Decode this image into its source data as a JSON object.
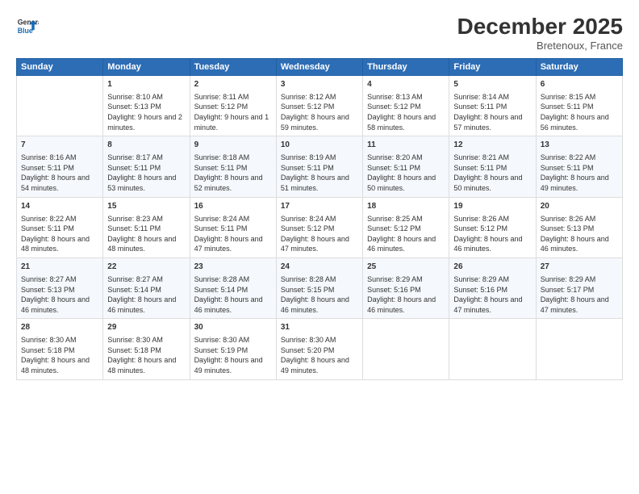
{
  "logo": {
    "line1": "General",
    "line2": "Blue"
  },
  "title": "December 2025",
  "subtitle": "Bretenoux, France",
  "days_header": [
    "Sunday",
    "Monday",
    "Tuesday",
    "Wednesday",
    "Thursday",
    "Friday",
    "Saturday"
  ],
  "weeks": [
    [
      {
        "day": "",
        "sunrise": "",
        "sunset": "",
        "daylight": ""
      },
      {
        "day": "1",
        "sunrise": "Sunrise: 8:10 AM",
        "sunset": "Sunset: 5:13 PM",
        "daylight": "Daylight: 9 hours and 2 minutes."
      },
      {
        "day": "2",
        "sunrise": "Sunrise: 8:11 AM",
        "sunset": "Sunset: 5:12 PM",
        "daylight": "Daylight: 9 hours and 1 minute."
      },
      {
        "day": "3",
        "sunrise": "Sunrise: 8:12 AM",
        "sunset": "Sunset: 5:12 PM",
        "daylight": "Daylight: 8 hours and 59 minutes."
      },
      {
        "day": "4",
        "sunrise": "Sunrise: 8:13 AM",
        "sunset": "Sunset: 5:12 PM",
        "daylight": "Daylight: 8 hours and 58 minutes."
      },
      {
        "day": "5",
        "sunrise": "Sunrise: 8:14 AM",
        "sunset": "Sunset: 5:11 PM",
        "daylight": "Daylight: 8 hours and 57 minutes."
      },
      {
        "day": "6",
        "sunrise": "Sunrise: 8:15 AM",
        "sunset": "Sunset: 5:11 PM",
        "daylight": "Daylight: 8 hours and 56 minutes."
      }
    ],
    [
      {
        "day": "7",
        "sunrise": "Sunrise: 8:16 AM",
        "sunset": "Sunset: 5:11 PM",
        "daylight": "Daylight: 8 hours and 54 minutes."
      },
      {
        "day": "8",
        "sunrise": "Sunrise: 8:17 AM",
        "sunset": "Sunset: 5:11 PM",
        "daylight": "Daylight: 8 hours and 53 minutes."
      },
      {
        "day": "9",
        "sunrise": "Sunrise: 8:18 AM",
        "sunset": "Sunset: 5:11 PM",
        "daylight": "Daylight: 8 hours and 52 minutes."
      },
      {
        "day": "10",
        "sunrise": "Sunrise: 8:19 AM",
        "sunset": "Sunset: 5:11 PM",
        "daylight": "Daylight: 8 hours and 51 minutes."
      },
      {
        "day": "11",
        "sunrise": "Sunrise: 8:20 AM",
        "sunset": "Sunset: 5:11 PM",
        "daylight": "Daylight: 8 hours and 50 minutes."
      },
      {
        "day": "12",
        "sunrise": "Sunrise: 8:21 AM",
        "sunset": "Sunset: 5:11 PM",
        "daylight": "Daylight: 8 hours and 50 minutes."
      },
      {
        "day": "13",
        "sunrise": "Sunrise: 8:22 AM",
        "sunset": "Sunset: 5:11 PM",
        "daylight": "Daylight: 8 hours and 49 minutes."
      }
    ],
    [
      {
        "day": "14",
        "sunrise": "Sunrise: 8:22 AM",
        "sunset": "Sunset: 5:11 PM",
        "daylight": "Daylight: 8 hours and 48 minutes."
      },
      {
        "day": "15",
        "sunrise": "Sunrise: 8:23 AM",
        "sunset": "Sunset: 5:11 PM",
        "daylight": "Daylight: 8 hours and 48 minutes."
      },
      {
        "day": "16",
        "sunrise": "Sunrise: 8:24 AM",
        "sunset": "Sunset: 5:11 PM",
        "daylight": "Daylight: 8 hours and 47 minutes."
      },
      {
        "day": "17",
        "sunrise": "Sunrise: 8:24 AM",
        "sunset": "Sunset: 5:12 PM",
        "daylight": "Daylight: 8 hours and 47 minutes."
      },
      {
        "day": "18",
        "sunrise": "Sunrise: 8:25 AM",
        "sunset": "Sunset: 5:12 PM",
        "daylight": "Daylight: 8 hours and 46 minutes."
      },
      {
        "day": "19",
        "sunrise": "Sunrise: 8:26 AM",
        "sunset": "Sunset: 5:12 PM",
        "daylight": "Daylight: 8 hours and 46 minutes."
      },
      {
        "day": "20",
        "sunrise": "Sunrise: 8:26 AM",
        "sunset": "Sunset: 5:13 PM",
        "daylight": "Daylight: 8 hours and 46 minutes."
      }
    ],
    [
      {
        "day": "21",
        "sunrise": "Sunrise: 8:27 AM",
        "sunset": "Sunset: 5:13 PM",
        "daylight": "Daylight: 8 hours and 46 minutes."
      },
      {
        "day": "22",
        "sunrise": "Sunrise: 8:27 AM",
        "sunset": "Sunset: 5:14 PM",
        "daylight": "Daylight: 8 hours and 46 minutes."
      },
      {
        "day": "23",
        "sunrise": "Sunrise: 8:28 AM",
        "sunset": "Sunset: 5:14 PM",
        "daylight": "Daylight: 8 hours and 46 minutes."
      },
      {
        "day": "24",
        "sunrise": "Sunrise: 8:28 AM",
        "sunset": "Sunset: 5:15 PM",
        "daylight": "Daylight: 8 hours and 46 minutes."
      },
      {
        "day": "25",
        "sunrise": "Sunrise: 8:29 AM",
        "sunset": "Sunset: 5:16 PM",
        "daylight": "Daylight: 8 hours and 46 minutes."
      },
      {
        "day": "26",
        "sunrise": "Sunrise: 8:29 AM",
        "sunset": "Sunset: 5:16 PM",
        "daylight": "Daylight: 8 hours and 47 minutes."
      },
      {
        "day": "27",
        "sunrise": "Sunrise: 8:29 AM",
        "sunset": "Sunset: 5:17 PM",
        "daylight": "Daylight: 8 hours and 47 minutes."
      }
    ],
    [
      {
        "day": "28",
        "sunrise": "Sunrise: 8:30 AM",
        "sunset": "Sunset: 5:18 PM",
        "daylight": "Daylight: 8 hours and 48 minutes."
      },
      {
        "day": "29",
        "sunrise": "Sunrise: 8:30 AM",
        "sunset": "Sunset: 5:18 PM",
        "daylight": "Daylight: 8 hours and 48 minutes."
      },
      {
        "day": "30",
        "sunrise": "Sunrise: 8:30 AM",
        "sunset": "Sunset: 5:19 PM",
        "daylight": "Daylight: 8 hours and 49 minutes."
      },
      {
        "day": "31",
        "sunrise": "Sunrise: 8:30 AM",
        "sunset": "Sunset: 5:20 PM",
        "daylight": "Daylight: 8 hours and 49 minutes."
      },
      {
        "day": "",
        "sunrise": "",
        "sunset": "",
        "daylight": ""
      },
      {
        "day": "",
        "sunrise": "",
        "sunset": "",
        "daylight": ""
      },
      {
        "day": "",
        "sunrise": "",
        "sunset": "",
        "daylight": ""
      }
    ]
  ]
}
